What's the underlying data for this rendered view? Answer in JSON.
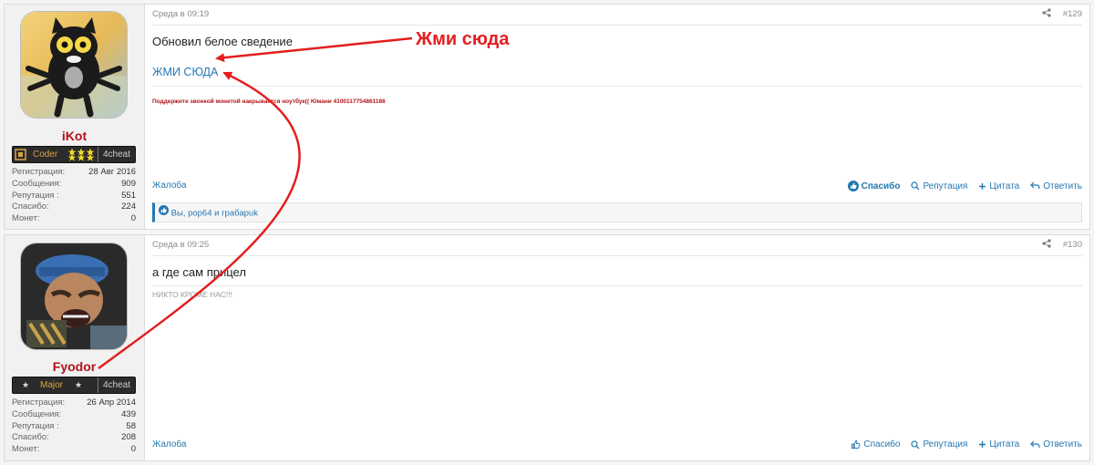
{
  "posts": [
    {
      "username": "iKot",
      "rank": "Coder",
      "site": "4cheat",
      "stats": [
        {
          "label": "Регистрация:",
          "value": "28 Авг 2016"
        },
        {
          "label": "Сообщения:",
          "value": "909"
        },
        {
          "label": "Репутация :",
          "value": "551"
        },
        {
          "label": "Спасибо:",
          "value": "224"
        },
        {
          "label": "Монет:",
          "value": "0"
        }
      ],
      "date": "Среда в 09:19",
      "number": "#129",
      "message": "Обновил белое сведение",
      "link_text": "ЖМИ СЮДА",
      "signature": "Поддержите звонкой монетой накрывается ноутбук(( Юмани 4100117754861186",
      "report": "Жалоба",
      "thanks": "Спасибо",
      "reputation": "Репутация",
      "quote": "Цитата",
      "reply": "Ответить",
      "likes": "Вы, pop64 и грабаpuk"
    },
    {
      "username": "Fyodor",
      "rank": "Major",
      "site": "4cheat",
      "stats": [
        {
          "label": "Регистрация:",
          "value": "26 Апр 2014"
        },
        {
          "label": "Сообщения:",
          "value": "439"
        },
        {
          "label": "Репутация :",
          "value": "58"
        },
        {
          "label": "Спасибо:",
          "value": "208"
        },
        {
          "label": "Монет:",
          "value": "0"
        }
      ],
      "date": "Среда в 09:25",
      "number": "#130",
      "message": "а где сам прицел",
      "signature": "НИКТО КРОМЕ НАС!!!",
      "report": "Жалоба",
      "thanks": "Спасибо",
      "reputation": "Репутация",
      "quote": "Цитата",
      "reply": "Ответить"
    }
  ],
  "annotation": {
    "text": "Жми сюда",
    "color": "#e41e1e"
  },
  "colors": {
    "link": "#2577b1",
    "username": "#b31217",
    "arrow": "#e41e1e"
  }
}
